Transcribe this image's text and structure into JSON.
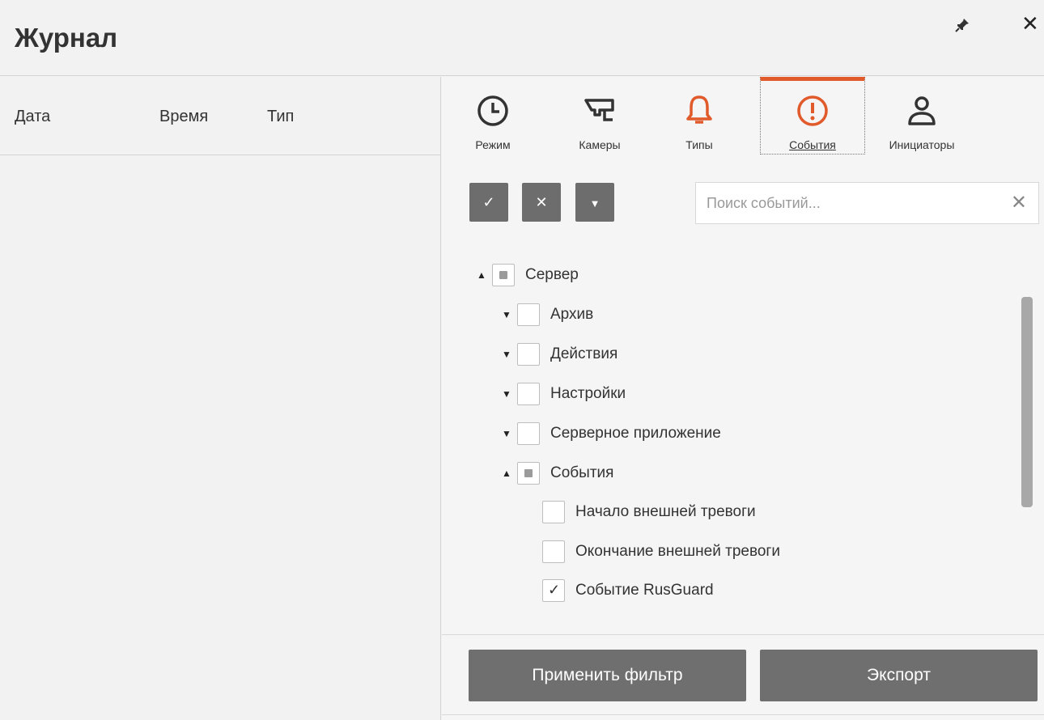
{
  "window": {
    "title": "Журнал"
  },
  "columns": [
    "Дата",
    "Время",
    "Тип"
  ],
  "tabs": [
    {
      "label": "Режим",
      "icon": "clock-icon"
    },
    {
      "label": "Камеры",
      "icon": "camera-icon"
    },
    {
      "label": "Типы",
      "icon": "bell-icon"
    },
    {
      "label": "События",
      "icon": "alert-circle-icon",
      "active": true
    },
    {
      "label": "Инициаторы",
      "icon": "user-icon"
    }
  ],
  "search": {
    "placeholder": "Поиск событий..."
  },
  "tree": [
    {
      "label": "Сервер",
      "state": "partial",
      "expanded": true
    },
    {
      "label": "Архив",
      "state": "unchecked",
      "expanded": false
    },
    {
      "label": "Действия",
      "state": "unchecked",
      "expanded": false
    },
    {
      "label": "Настройки",
      "state": "unchecked",
      "expanded": false
    },
    {
      "label": "Серверное приложение",
      "state": "unchecked",
      "expanded": false
    },
    {
      "label": "События",
      "state": "partial",
      "expanded": true
    },
    {
      "label": "Начало внешней тревоги",
      "state": "unchecked"
    },
    {
      "label": "Окончание внешней тревоги",
      "state": "unchecked"
    },
    {
      "label": "Событие RusGuard",
      "state": "checked"
    }
  ],
  "buttons": {
    "apply": "Применить фильтр",
    "export": "Экспорт"
  },
  "colors": {
    "accent": "#e05a2b",
    "button": "#6f6f6f"
  }
}
